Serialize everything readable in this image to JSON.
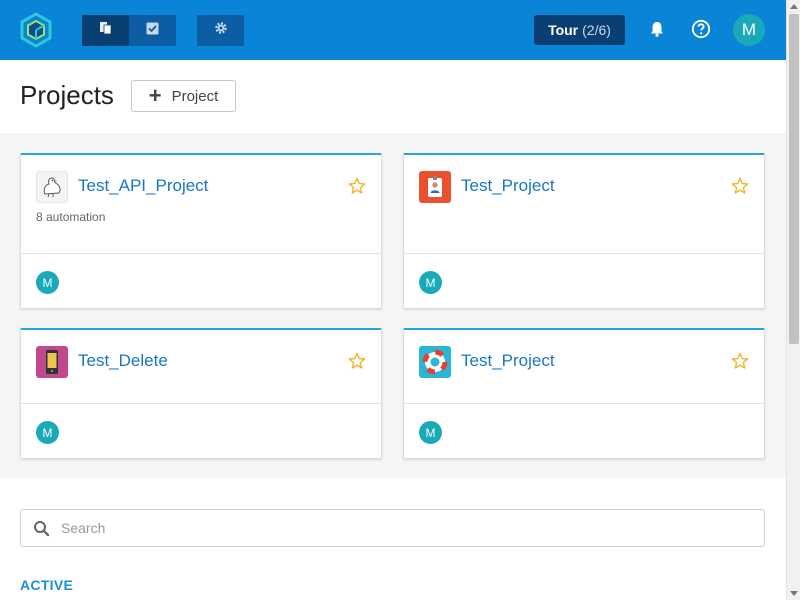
{
  "topbar": {
    "logo_icon": "hexagon-logo-icon",
    "nav": [
      {
        "icon": "documents-icon",
        "active": true
      },
      {
        "icon": "checkbox-icon",
        "active": false
      }
    ],
    "settings_icon": "gear-icon",
    "tour": {
      "label": "Tour",
      "progress": "(2/6)"
    },
    "notifications_icon": "bell-icon",
    "help_icon": "question-circle-icon",
    "avatar_initial": "M",
    "bg_color": "#0a84d6"
  },
  "header": {
    "title": "Projects",
    "add_button_label": "Project"
  },
  "projects": [
    {
      "name": "Test_API_Project",
      "meta": "8 automation",
      "icon": "pigeon-icon",
      "member": "M",
      "starred": false
    },
    {
      "name": "Test_Project",
      "meta": "",
      "icon": "id-badge-icon",
      "member": "M",
      "starred": false
    },
    {
      "name": "Test_Delete",
      "meta": "",
      "icon": "mobile-phone-icon",
      "member": "M",
      "starred": false
    },
    {
      "name": "Test_Project",
      "meta": "",
      "icon": "lifebuoy-icon",
      "member": "M",
      "starred": false
    }
  ],
  "search": {
    "placeholder": "Search",
    "value": ""
  },
  "section_label": "ACTIVE",
  "colors": {
    "accent": "#1a76c4",
    "card_border_top": "#2aa5dc",
    "avatar": "#1aa9b8",
    "star": "#f0b429",
    "section_label": "#1a8fd6"
  }
}
